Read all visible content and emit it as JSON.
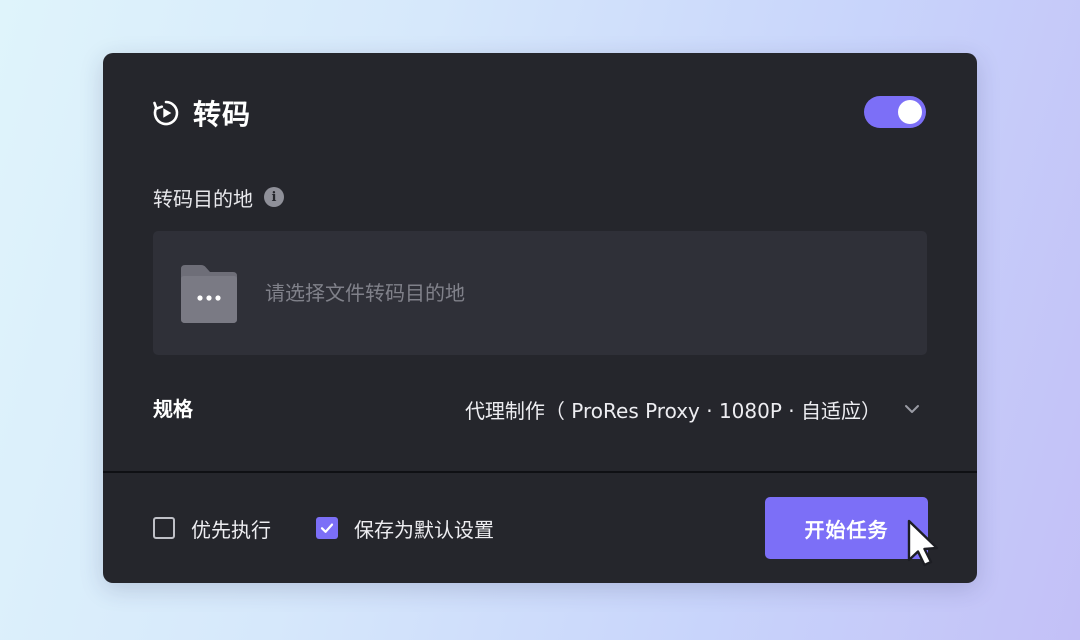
{
  "panel": {
    "title": "转码",
    "enabled": true,
    "accent_color": "#7c6ff7"
  },
  "destination": {
    "label": "转码目的地",
    "info_icon": "info-icon",
    "placeholder": "请选择文件转码目的地",
    "icon": "folder-more-icon"
  },
  "spec": {
    "label": "规格",
    "value": "代理制作（ ProRes Proxy · 1080P · 自适应）"
  },
  "options": {
    "priority": {
      "label": "优先执行",
      "checked": false
    },
    "save_default": {
      "label": "保存为默认设置",
      "checked": true
    }
  },
  "actions": {
    "start_label": "开始任务"
  }
}
